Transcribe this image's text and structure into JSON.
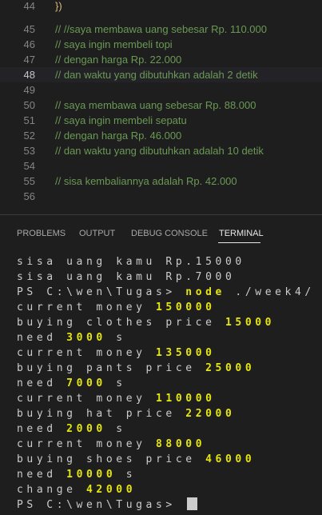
{
  "editor": {
    "lines": [
      {
        "num": "44",
        "text": "})"
      },
      {
        "num": "45",
        "text": "// //saya membawa uang sebesar Rp. 110.000"
      },
      {
        "num": "46",
        "text": "// saya ingin membeli topi"
      },
      {
        "num": "47",
        "text": "// dengan harga Rp. 22.000"
      },
      {
        "num": "48",
        "text": "// dan waktu yang dibutuhkan adalah 2 detik"
      },
      {
        "num": "49",
        "text": ""
      },
      {
        "num": "50",
        "text": "// saya membawa uang sebesar Rp. 88.000"
      },
      {
        "num": "51",
        "text": "// saya ingin membeli sepatu"
      },
      {
        "num": "52",
        "text": "// dengan harga Rp. 46.000"
      },
      {
        "num": "53",
        "text": "// dan waktu yang dibutuhkan adalah 10 detik"
      },
      {
        "num": "54",
        "text": ""
      },
      {
        "num": "55",
        "text": "// sisa kembaliannya adalah Rp. 42.000"
      },
      {
        "num": "56",
        "text": ""
      }
    ]
  },
  "panel": {
    "tabs": [
      "PROBLEMS",
      "OUTPUT",
      "DEBUG CONSOLE",
      "TERMINAL"
    ],
    "active_tab": "TERMINAL"
  },
  "terminal": {
    "lines": [
      {
        "pre": "sisa uang kamu Rp.15000",
        "hl": "",
        "post": ""
      },
      {
        "pre": "sisa uang kamu Rp.7000",
        "hl": "",
        "post": ""
      },
      {
        "pre": "PS C:\\wen\\Tugas> ",
        "hl": "node",
        "post": " ./week4/"
      },
      {
        "pre": "current money ",
        "hl": "150000",
        "post": ""
      },
      {
        "pre": "buying clothes price ",
        "hl": "15000",
        "post": ""
      },
      {
        "pre": "need ",
        "hl": "3000",
        "post": " s"
      },
      {
        "pre": "current money ",
        "hl": "135000",
        "post": ""
      },
      {
        "pre": "buying pants price ",
        "hl": "25000",
        "post": ""
      },
      {
        "pre": "need ",
        "hl": "7000",
        "post": " s"
      },
      {
        "pre": "current money ",
        "hl": "110000",
        "post": ""
      },
      {
        "pre": "buying hat price ",
        "hl": "22000",
        "post": ""
      },
      {
        "pre": "need ",
        "hl": "2000",
        "post": " s"
      },
      {
        "pre": "current money ",
        "hl": "88000",
        "post": ""
      },
      {
        "pre": "buying shoes price ",
        "hl": "46000",
        "post": ""
      },
      {
        "pre": "need ",
        "hl": "10000",
        "post": " s"
      },
      {
        "pre": "change ",
        "hl": "42000",
        "post": ""
      },
      {
        "pre": "PS C:\\wen\\Tugas> ",
        "hl": "",
        "post": ""
      }
    ]
  },
  "colors": {
    "comment": "#6a9955",
    "highlight": "#e5e510",
    "text": "#cccccc",
    "background": "#1e1e1e"
  }
}
